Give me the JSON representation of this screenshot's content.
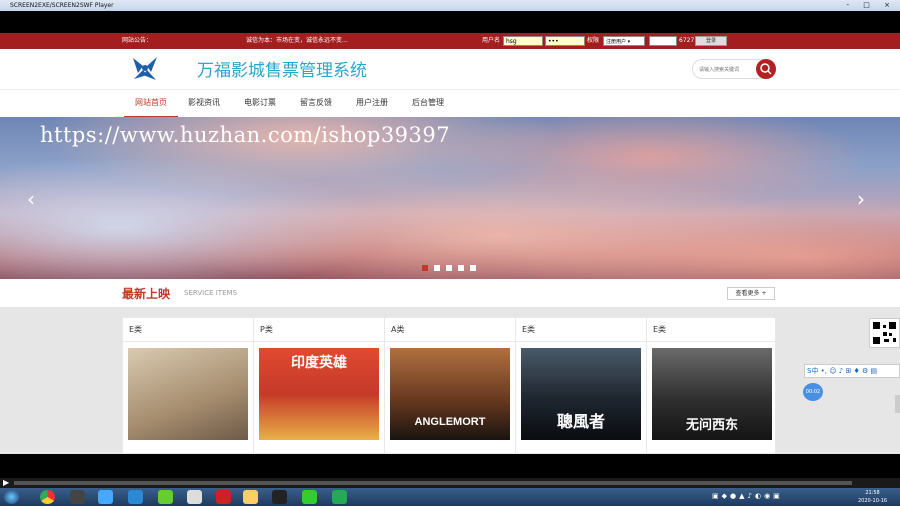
{
  "window": {
    "title": "SCREEN2EXE/SCREEN2SWF Player",
    "controls": "- □ ×"
  },
  "notice": {
    "label": "网站公告：",
    "scroll_text": "诚信为本：市场在变，诚信永远不变...",
    "username_label": "用户名",
    "username_value": "hsg",
    "password_value": "•••",
    "role_label": "权限",
    "role_selected": "注册用户 ▾",
    "code_value": "6727",
    "login_button": "登录"
  },
  "header": {
    "site_title": "万福影城售票管理系统",
    "search_placeholder": "请输入搜索关键词"
  },
  "nav": {
    "items": [
      {
        "label": "网站首页"
      },
      {
        "label": "影视资讯"
      },
      {
        "label": "电影订票"
      },
      {
        "label": "留言反馈"
      },
      {
        "label": "用户注册"
      },
      {
        "label": "后台管理"
      }
    ]
  },
  "banner": {
    "watermark": "https://www.huzhan.com/ishop39397",
    "prev": "‹",
    "next": "›",
    "slide_count": 5,
    "active_slide": 1
  },
  "section": {
    "title": "最新上映",
    "subtitle": "SERVICE ITEMS",
    "more_button": "查看更多 +"
  },
  "cards": [
    {
      "category": "E类",
      "poster_text": "",
      "poster_colors": [
        "#c9b8a0",
        "#8a6e58"
      ]
    },
    {
      "category": "P类",
      "poster_text": "印度英雄",
      "poster_colors": [
        "#d33a2a",
        "#e7a540"
      ]
    },
    {
      "category": "A类",
      "poster_text": "ANGLEMORT",
      "poster_colors": [
        "#8a4e2a",
        "#2a2018"
      ]
    },
    {
      "category": "E类",
      "poster_text": "聰風者",
      "poster_colors": [
        "#3a4a58",
        "#0e1218"
      ]
    },
    {
      "category": "E类",
      "poster_text": "无问西东",
      "poster_colors": [
        "#5a5a5a",
        "#1a1a1a"
      ]
    }
  ],
  "float_widget": {
    "toolbar": "S中 •, ☺ ♪ ⊞ ♦ ⚙ ▤",
    "bubble": "00:02"
  },
  "taskbar": {
    "time": "21:58",
    "date": "2020-10-16"
  }
}
